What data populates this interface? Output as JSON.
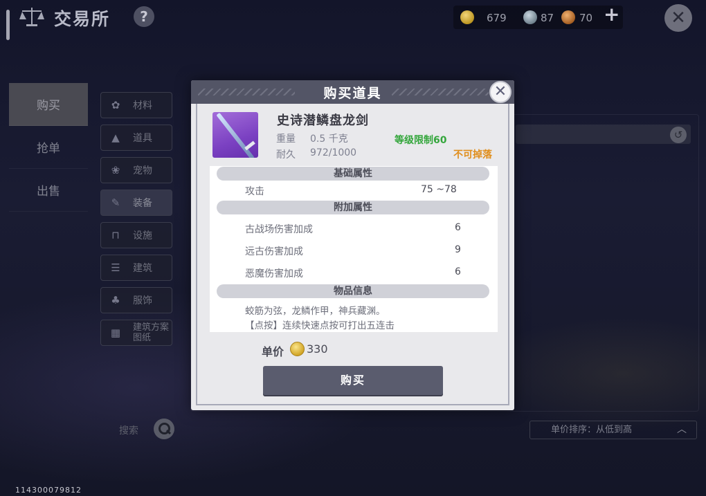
{
  "header": {
    "title": "交易所",
    "help_label": "?",
    "currency": [
      {
        "icon": "gold-coin-icon",
        "value": "679"
      },
      {
        "icon": "silver-coin-icon",
        "value": "87"
      },
      {
        "icon": "bronze-coin-icon",
        "value": "70"
      }
    ],
    "add_label": "+",
    "close_label": "✕"
  },
  "main_tabs": [
    {
      "label": "购买",
      "active": true
    },
    {
      "label": "抢单",
      "active": false
    },
    {
      "label": "出售",
      "active": false
    }
  ],
  "categories": [
    {
      "label": "材料",
      "icon": "material-icon"
    },
    {
      "label": "道具",
      "icon": "item-icon"
    },
    {
      "label": "宠物",
      "icon": "pet-paw-icon"
    },
    {
      "label": "装备",
      "icon": "equipment-icon",
      "active": true
    },
    {
      "label": "设施",
      "icon": "facility-icon"
    },
    {
      "label": "建筑",
      "icon": "building-icon"
    },
    {
      "label": "服饰",
      "icon": "clothing-icon"
    },
    {
      "label": "建筑方案图纸",
      "line1": "建筑方案",
      "line2": "图纸",
      "icon": "blueprint-icon"
    }
  ],
  "search": {
    "label": "搜索"
  },
  "sort": {
    "label": "单价排序：从低到高"
  },
  "uid": "114300079812",
  "modal": {
    "title": "购买道具",
    "close_label": "✕",
    "item": {
      "name": "史诗潜鳞盘龙剑",
      "weight_label": "重量",
      "weight_value": "0.5 千克",
      "durability_label": "耐久",
      "durability_value": "972/1000",
      "level_limit": "等级限制60",
      "no_drop": "不可掉落"
    },
    "sections": {
      "base": {
        "title": "基础属性",
        "rows": [
          {
            "label": "攻击",
            "value": "75 ~78"
          }
        ]
      },
      "extra": {
        "title": "附加属性",
        "rows": [
          {
            "label": "古战场伤害加成",
            "value": "6"
          },
          {
            "label": "远古伤害加成",
            "value": "9"
          },
          {
            "label": "恶魔伤害加成",
            "value": "6"
          }
        ]
      },
      "info": {
        "title": "物品信息",
        "lines": [
          "蛟筋为弦，龙鳞作甲，神兵藏渊。",
          "【点按】连续快速点按可打出五连击"
        ]
      }
    },
    "price_label": "单价",
    "price_value": "330",
    "buy_label": "购买"
  },
  "colors": {
    "level_limit": "#34a63c",
    "no_drop": "#e08e1c",
    "item_rarity": "#7b41c2",
    "buy_button": "#5a5c6e"
  }
}
